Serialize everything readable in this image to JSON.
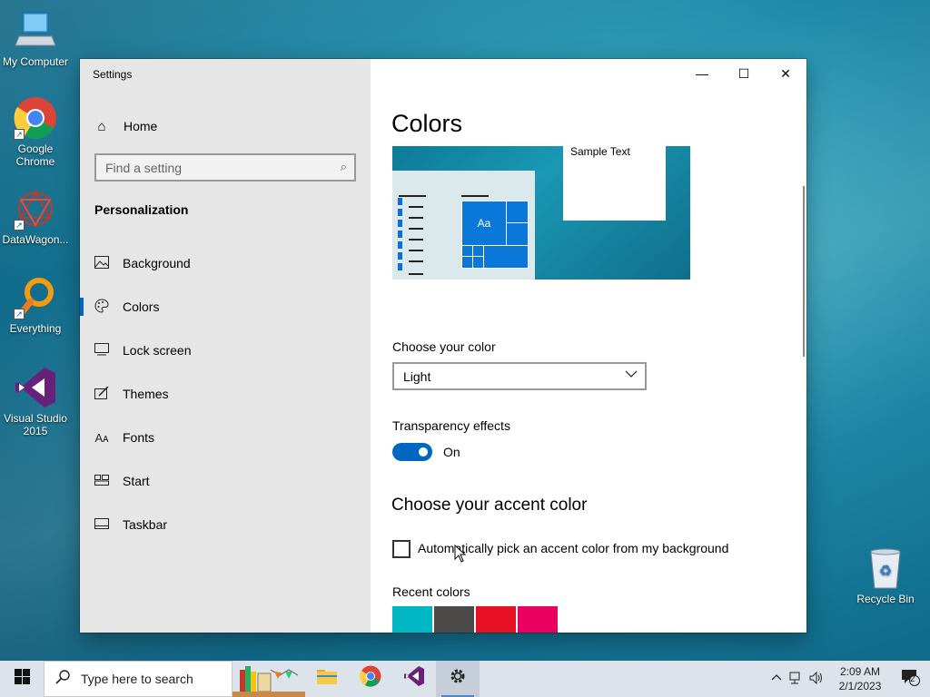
{
  "desktop": {
    "icons": [
      {
        "label": "My Computer"
      },
      {
        "label": "Google Chrome"
      },
      {
        "label": "DataWagon..."
      },
      {
        "label": "Everything"
      },
      {
        "label": "Visual Studio 2015"
      },
      {
        "label": "Recycle Bin"
      }
    ]
  },
  "window": {
    "title": "Settings",
    "caption": {
      "minimize": "—",
      "maximize": "☐",
      "close": "✕"
    }
  },
  "sidebar": {
    "home_label": "Home",
    "search_placeholder": "Find a setting",
    "section_title": "Personalization",
    "items": [
      {
        "label": "Background",
        "icon": "image-icon"
      },
      {
        "label": "Colors",
        "icon": "palette-icon",
        "selected": true
      },
      {
        "label": "Lock screen",
        "icon": "lock-screen-icon"
      },
      {
        "label": "Themes",
        "icon": "themes-icon"
      },
      {
        "label": "Fonts",
        "icon": "fonts-icon"
      },
      {
        "label": "Start",
        "icon": "start-icon"
      },
      {
        "label": "Taskbar",
        "icon": "taskbar-icon"
      }
    ]
  },
  "main": {
    "title": "Colors",
    "preview": {
      "sample_text": "Sample Text",
      "tile_text": "Aa"
    },
    "choose_color_label": "Choose your color",
    "choose_color_value": "Light",
    "transparency_label": "Transparency effects",
    "transparency_state": "On",
    "accent_heading": "Choose your accent color",
    "auto_accent_label": "Automatically pick an accent color from my background",
    "recent_colors_label": "Recent colors",
    "recent_colors": [
      "#00b7c3",
      "#4c4a48",
      "#e81123",
      "#ea005e"
    ],
    "accent": "#0067c0"
  },
  "taskbar": {
    "search_placeholder": "Type here to search",
    "time": "2:09 AM",
    "date": "2/1/2023",
    "notification_count": "2"
  }
}
